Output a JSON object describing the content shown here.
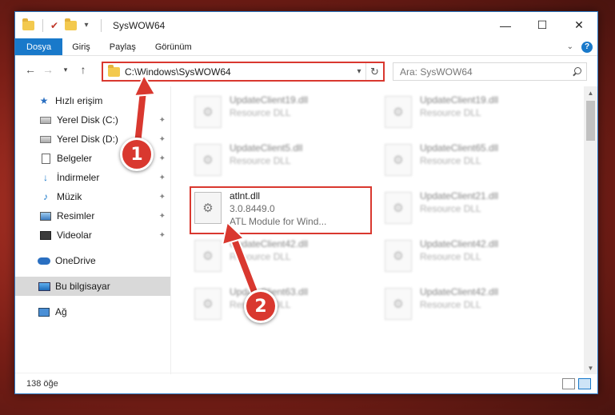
{
  "window": {
    "title": "SysWOW64",
    "controls": {
      "minimize": "—",
      "maximize": "☐",
      "close": "✕"
    }
  },
  "ribbon": {
    "tabs": [
      "Dosya",
      "Giriş",
      "Paylaş",
      "Görünüm"
    ],
    "help": "?"
  },
  "address": {
    "path": "C:\\Windows\\SysWOW64"
  },
  "search": {
    "placeholder": "Ara: SysWOW64"
  },
  "sidebar": {
    "items": [
      {
        "label": "Hızlı erişim",
        "icon": "star-icon"
      },
      {
        "label": "Yerel Disk (C:)",
        "icon": "drive-icon"
      },
      {
        "label": "Yerel Disk (D:)",
        "icon": "drive-icon"
      },
      {
        "label": "Belgeler",
        "icon": "documents-icon"
      },
      {
        "label": "İndirmeler",
        "icon": "download-icon"
      },
      {
        "label": "Müzik",
        "icon": "music-icon"
      },
      {
        "label": "Resimler",
        "icon": "pictures-icon"
      },
      {
        "label": "Videolar",
        "icon": "videos-icon"
      },
      {
        "label": "OneDrive",
        "icon": "cloud-icon"
      },
      {
        "label": "Bu bilgisayar",
        "icon": "computer-icon"
      },
      {
        "label": "Ağ",
        "icon": "network-icon"
      }
    ]
  },
  "files": [
    {
      "name": "UpdateClient19.dll",
      "desc": "Resource DLL"
    },
    {
      "name": "UpdateClient19.dll",
      "desc": "Resource DLL"
    },
    {
      "name": "UpdateClient5.dll",
      "desc": "Resource DLL"
    },
    {
      "name": "UpdateClient65.dll",
      "desc": "Resource DLL"
    },
    {
      "name": "atlnt.dll",
      "version": "3.0.8449.0",
      "desc": "ATL Module for Wind..."
    },
    {
      "name": "UpdateClient21.dll",
      "desc": "Resource DLL"
    },
    {
      "name": "UpdateClient42.dll",
      "desc": "Resource DLL"
    },
    {
      "name": "UpdateClient42.dll",
      "desc": "Resource DLL"
    },
    {
      "name": "UpdateClient63.dll",
      "desc": "Resource DLL"
    },
    {
      "name": "UpdateClient42.dll",
      "desc": "Resource DLL"
    }
  ],
  "status": {
    "count": "138 öğe"
  },
  "callouts": [
    "1",
    "2"
  ],
  "colors": {
    "accent": "#1979ca",
    "highlight": "#d9382f"
  }
}
